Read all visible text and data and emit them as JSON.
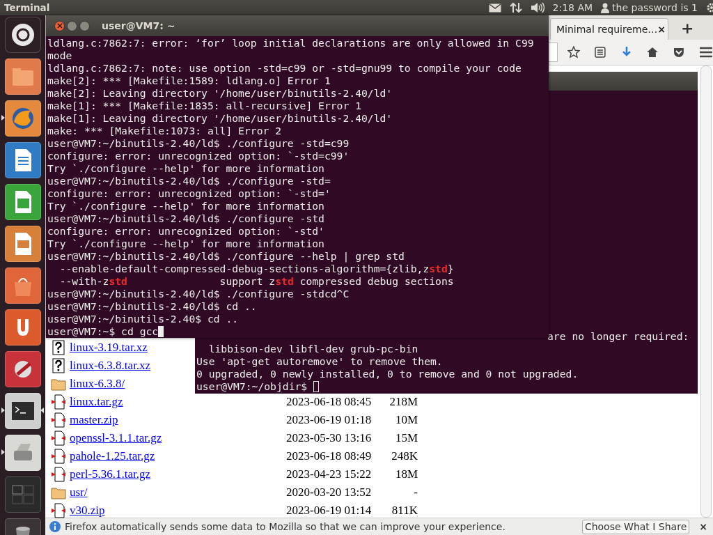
{
  "top_panel": {
    "app_title": "Terminal",
    "clock": "2:18 AM",
    "user": "the password is 1"
  },
  "launcher": {
    "items": [
      {
        "kind": "dash",
        "running": false,
        "focused": false
      },
      {
        "kind": "files",
        "running": false,
        "focused": false
      },
      {
        "kind": "browser",
        "running": true,
        "focused": false
      },
      {
        "kind": "writer",
        "running": false,
        "focused": false
      },
      {
        "kind": "calc",
        "running": false,
        "focused": false
      },
      {
        "kind": "impress",
        "running": false,
        "focused": false
      },
      {
        "kind": "store",
        "running": false,
        "focused": false
      },
      {
        "kind": "ubuntu-one",
        "running": false,
        "focused": false
      },
      {
        "kind": "settings",
        "running": false,
        "focused": false
      },
      {
        "kind": "terminal",
        "running": true,
        "focused": true
      },
      {
        "kind": "scanner",
        "running": true,
        "focused": false
      },
      {
        "kind": "workspaces",
        "running": false,
        "focused": false
      },
      {
        "kind": "trash",
        "running": false,
        "focused": false
      }
    ]
  },
  "browser": {
    "tab": {
      "title": "Minimal requireme…",
      "close": "×"
    },
    "new_tab": "+",
    "file_list": [
      {
        "kind": "unknown",
        "name": "linux-3.19.tar.xz"
      },
      {
        "kind": "unknown",
        "name": "linux-6.3.8.tar.xz"
      },
      {
        "kind": "folder",
        "name": "linux-6.3.8/"
      },
      {
        "kind": "archive",
        "name": "linux.tar.gz",
        "modified": "2023-06-18 08:45",
        "size": "218M"
      },
      {
        "kind": "archive",
        "name": "master.zip",
        "modified": "2023-06-19 01:18",
        "size": "10M"
      },
      {
        "kind": "archive",
        "name": "openssl-3.1.1.tar.gz",
        "modified": "2023-05-30 13:16",
        "size": "15M"
      },
      {
        "kind": "archive",
        "name": "pahole-1.25.tar.gz",
        "modified": "2023-06-18 08:49",
        "size": "248K"
      },
      {
        "kind": "archive",
        "name": "perl-5.36.1.tar.gz",
        "modified": "2023-04-23 15:22",
        "size": "18M"
      },
      {
        "kind": "folder",
        "name": "usr/",
        "modified": "2020-03-20 13:52",
        "size": "-"
      },
      {
        "kind": "archive",
        "name": "v30.zip",
        "modified": "2023-06-19 01:14",
        "size": "811K"
      }
    ],
    "notification": {
      "text": "Firefox automatically sends some data to Mozilla so that we can improve your experience.",
      "button": "Choose What I Share",
      "close": "×"
    }
  },
  "terminal_back": {
    "lines": [
      {
        "text": "are no longer required:",
        "kind": "tail"
      },
      {
        "text": "  libbison-dev libfl-dev grub-pc-bin"
      },
      {
        "text": "Use 'apt-get autoremove' to remove them."
      },
      {
        "text": "0 upgraded, 0 newly installed, 0 to remove and 0 not upgraded."
      },
      {
        "text": "user@VM7:~/objdir$ "
      }
    ],
    "focused": false
  },
  "terminal_front": {
    "title": "user@VM7: ~",
    "focused": true,
    "lines": [
      {
        "text": "ldlang.c:7862:7: error: ‘for’ loop initial declarations are only allowed in C99"
      },
      {
        "text": "mode"
      },
      {
        "text": "ldlang.c:7862:7: note: use option -std=c99 or -std=gnu99 to compile your code"
      },
      {
        "text": "make[2]: *** [Makefile:1589: ldlang.o] Error 1"
      },
      {
        "text": "make[2]: Leaving directory '/home/user/binutils-2.40/ld'"
      },
      {
        "text": "make[1]: *** [Makefile:1835: all-recursive] Error 1"
      },
      {
        "text": "make[1]: Leaving directory '/home/user/binutils-2.40/ld'"
      },
      {
        "text": "make: *** [Makefile:1073: all] Error 2"
      },
      {
        "text": "user@VM7:~/binutils-2.40/ld$ ./configure -std=c99"
      },
      {
        "text": "configure: error: unrecognized option: `-std=c99'"
      },
      {
        "text": "Try `./configure --help' for more information"
      },
      {
        "text": "user@VM7:~/binutils-2.40/ld$ ./configure -std="
      },
      {
        "text": "configure: error: unrecognized option: `-std='"
      },
      {
        "text": "Try `./configure --help' for more information"
      },
      {
        "text": "user@VM7:~/binutils-2.40/ld$ ./configure -std"
      },
      {
        "text": "configure: error: unrecognized option: `-std'"
      },
      {
        "text": "Try `./configure --help' for more information"
      },
      {
        "text": "user@VM7:~/binutils-2.40/ld$ ./configure --help | grep std"
      },
      {
        "rich": "  --enable-default-compressed-debug-sections-algorithm={zlib,z**std**}"
      },
      {
        "rich": "  --with-z**std**               support z**std** compressed debug sections"
      },
      {
        "text": "user@VM7:~/binutils-2.40/ld$ ./configure -stdcd^C"
      },
      {
        "text": "user@VM7:~/binutils-2.40/ld$ cd .."
      },
      {
        "text": "user@VM7:~/binutils-2.40$ cd .."
      },
      {
        "text": "user@VM7:~$ cd gcc"
      }
    ]
  }
}
